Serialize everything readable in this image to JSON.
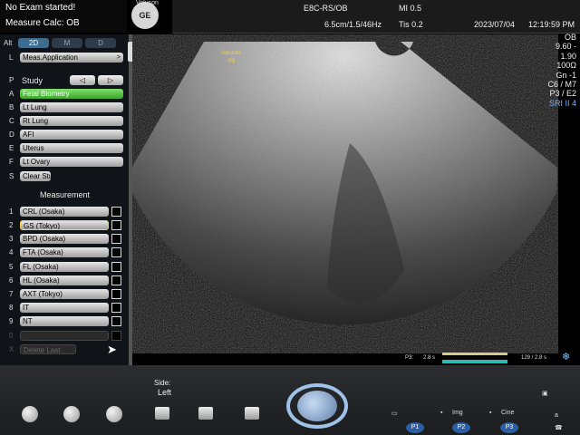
{
  "status": {
    "exam_message": "No Exam started!",
    "measure_calc": "Measure Calc: OB"
  },
  "probe_info": {
    "brand": "Voluson",
    "model": "P8",
    "logo": "GE"
  },
  "topbar": {
    "probe_app": "E8C-RS/OB",
    "scan_params": "6.5cm/1.5/46Hz",
    "mi": "MI  0.5",
    "tis": "Tis  0.2",
    "date": "2023/07/04",
    "time": "12:19:59 PM"
  },
  "left_panel": {
    "alt_key": "Alt",
    "modes": [
      "2D",
      "M",
      "D"
    ],
    "active_mode": "2D",
    "l_key": "L",
    "meas_application": "Meas.Application",
    "p_key": "P",
    "study_label": "Study",
    "study_prev_icon": "triangle-left-icon",
    "study_next_icon": "triangle-right-icon",
    "study_items": [
      {
        "key": "A",
        "label": "Fetal Biometry",
        "selected": true
      },
      {
        "key": "B",
        "label": "Lt Lung"
      },
      {
        "key": "C",
        "label": "Rt Lung"
      },
      {
        "key": "D",
        "label": "AFI"
      },
      {
        "key": "E",
        "label": "Uterus"
      },
      {
        "key": "F",
        "label": "Lt Ovary"
      },
      {
        "key": "S",
        "label": "Clear Study"
      }
    ],
    "measurement_title": "Measurement",
    "measurements": [
      {
        "key": "1",
        "label": "CRL (Osaka)"
      },
      {
        "key": "2",
        "label": "GS (Tokyo)"
      },
      {
        "key": "3",
        "label": "BPD (Osaka)"
      },
      {
        "key": "4",
        "label": "FTA (Osaka)"
      },
      {
        "key": "5",
        "label": "FL (Osaka)"
      },
      {
        "key": "6",
        "label": "HL (Osaka)"
      },
      {
        "key": "7",
        "label": "AXT (Tokyo)"
      },
      {
        "key": "8",
        "label": "IT"
      },
      {
        "key": "9",
        "label": "NT"
      },
      {
        "key": "0",
        "label": ""
      },
      {
        "key": "X",
        "label": "Delete Last"
      }
    ]
  },
  "image": {
    "brand": "Voluson",
    "model": "P8"
  },
  "right_params": [
    "OB",
    "9.60 - 1.90",
    "100Ω",
    "Gn  -1",
    "C6 / M7",
    "P3 / E2",
    "SRI II 4"
  ],
  "cine": {
    "left_label": "P3:",
    "left_duration": "2.8 s",
    "right_label": "129 / 2.8 s",
    "freeze_icon": "snowflake-icon",
    "bar_colors": [
      "#d8c986",
      "#2fb9b5"
    ]
  },
  "console": {
    "side_label": "Side:",
    "side_value": "Left",
    "img_label": "Img",
    "cine_label": "Cine",
    "p_buttons": [
      "P1",
      "P2",
      "P3"
    ],
    "trackball_icon": "trackball-icon"
  }
}
